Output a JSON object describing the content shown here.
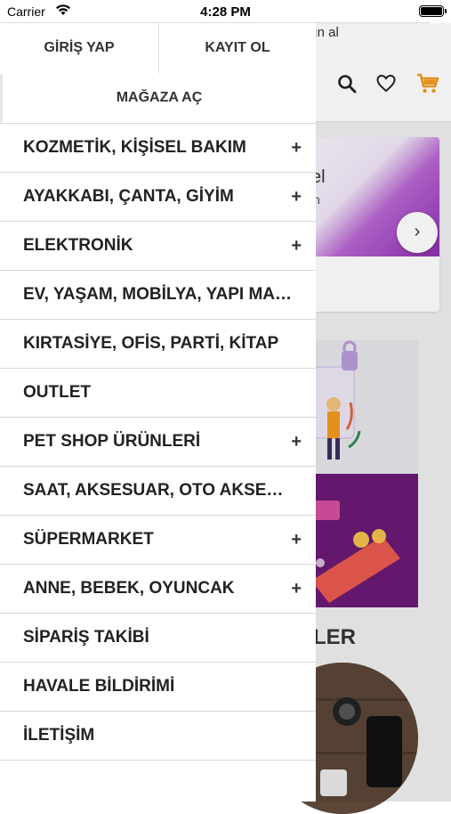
{
  "status_bar": {
    "carrier": "Carrier",
    "time": "4:28 PM"
  },
  "background": {
    "promo_text": "atın al",
    "banner_text1": "el",
    "banner_text2": "n",
    "next_arrow": "›",
    "section_title": "LER"
  },
  "drawer": {
    "login_label": "GİRİŞ YAP",
    "register_label": "KAYIT OL",
    "store_label": "MAĞAZA AÇ",
    "items": [
      {
        "label": "KOZMETİK, KİŞİSEL BAKIM",
        "expand": "+"
      },
      {
        "label": "AYAKKABI, ÇANTA, GİYİM",
        "expand": "+"
      },
      {
        "label": "ELEKTRONİK",
        "expand": "+"
      },
      {
        "label": "EV, YAŞAM, MOBİLYA, YAPI MARKET",
        "expand": ""
      },
      {
        "label": "KIRTASİYE, OFİS, PARTİ, KİTAP",
        "expand": ""
      },
      {
        "label": "OUTLET",
        "expand": ""
      },
      {
        "label": "PET SHOP ÜRÜNLERİ",
        "expand": "+"
      },
      {
        "label": "SAAT, AKSESUAR, OTO AKSESUAR",
        "expand": ""
      },
      {
        "label": "SÜPERMARKET",
        "expand": "+"
      },
      {
        "label": "ANNE, BEBEK, OYUNCAK",
        "expand": "+"
      },
      {
        "label": "SİPARİŞ TAKİBİ",
        "expand": ""
      },
      {
        "label": "HAVALE BİLDİRİMİ",
        "expand": ""
      },
      {
        "label": "İLETİŞİM",
        "expand": ""
      }
    ]
  },
  "colors": {
    "accent": "#f39a1e",
    "text": "#222222",
    "divider": "#d8d8d8"
  },
  "icons": [
    "wifi-icon",
    "battery-icon",
    "search-icon",
    "heart-icon",
    "cart-icon",
    "chevron-right-icon"
  ]
}
